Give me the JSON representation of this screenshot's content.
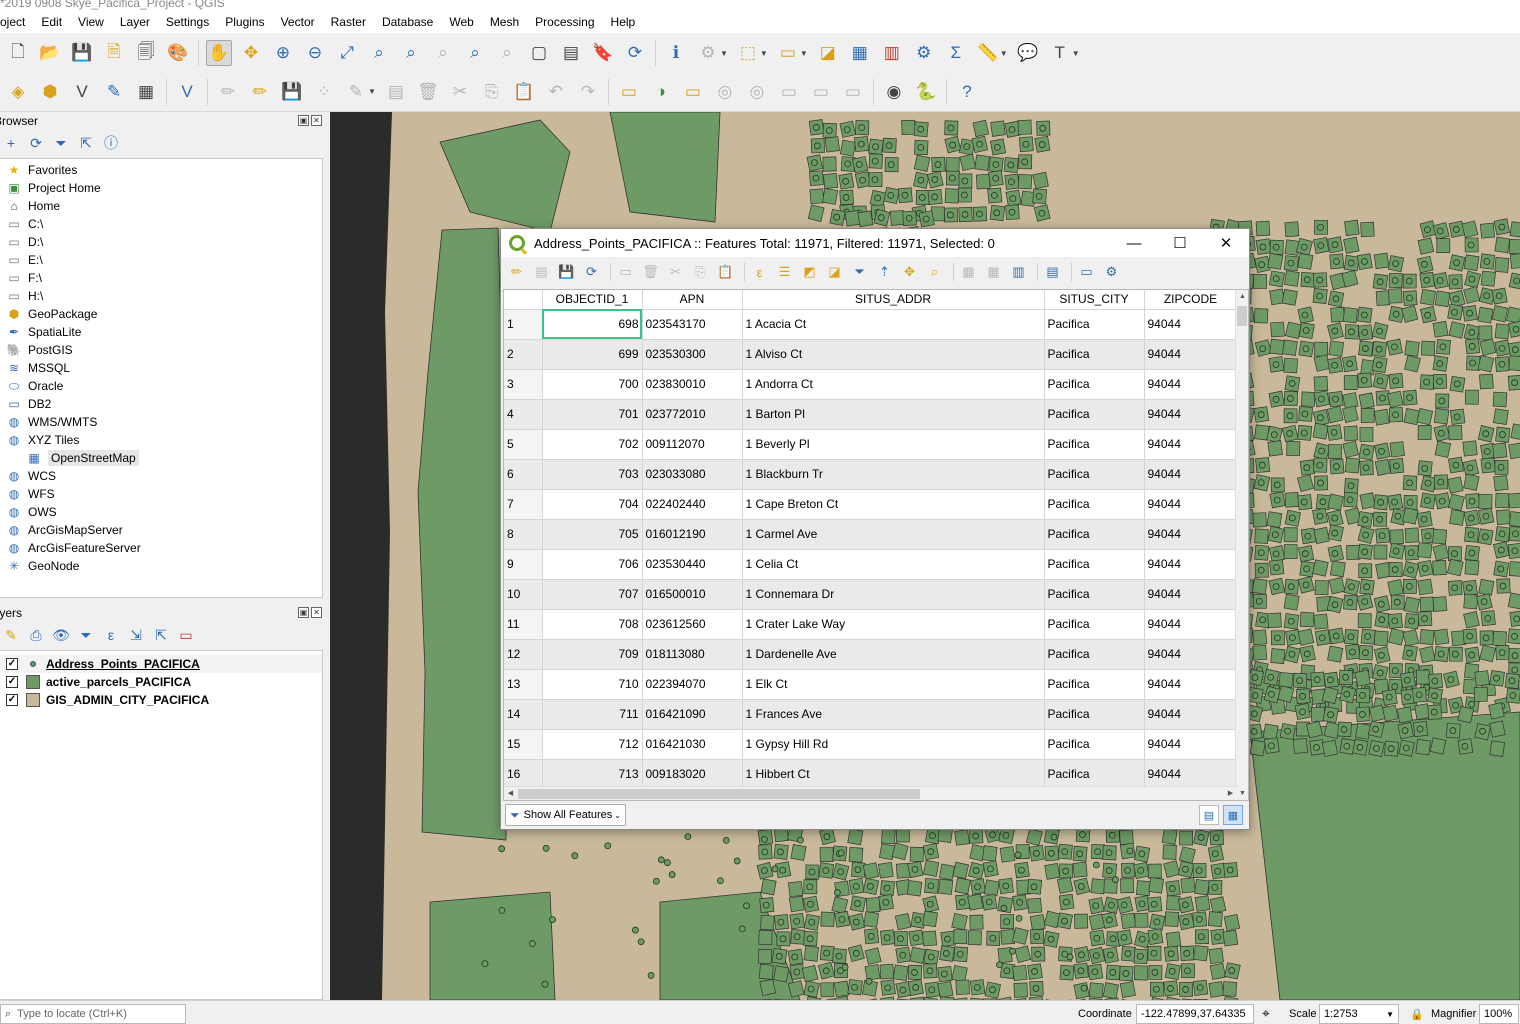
{
  "window": {
    "title": "*2019 0908 Skye_Pacifica_Project - QGIS"
  },
  "menu": [
    "Project",
    "Edit",
    "View",
    "Layer",
    "Settings",
    "Plugins",
    "Vector",
    "Raster",
    "Database",
    "Web",
    "Mesh",
    "Processing",
    "Help"
  ],
  "browser": {
    "title": "Browser",
    "items": [
      {
        "label": "Favorites",
        "icon": "star-icon"
      },
      {
        "label": "Project Home",
        "icon": "project-home-icon"
      },
      {
        "label": "Home",
        "icon": "home-folder-icon"
      },
      {
        "label": "C:\\",
        "icon": "drive-icon"
      },
      {
        "label": "D:\\",
        "icon": "drive-icon"
      },
      {
        "label": "E:\\",
        "icon": "drive-icon"
      },
      {
        "label": "F:\\",
        "icon": "drive-icon"
      },
      {
        "label": "H:\\",
        "icon": "drive-icon"
      },
      {
        "label": "GeoPackage",
        "icon": "geopackage-icon"
      },
      {
        "label": "SpatiaLite",
        "icon": "spatialite-icon"
      },
      {
        "label": "PostGIS",
        "icon": "postgis-icon"
      },
      {
        "label": "MSSQL",
        "icon": "mssql-icon"
      },
      {
        "label": "Oracle",
        "icon": "oracle-icon"
      },
      {
        "label": "DB2",
        "icon": "db2-icon"
      },
      {
        "label": "WMS/WMTS",
        "icon": "globe-icon"
      },
      {
        "label": "XYZ Tiles",
        "icon": "globe-icon"
      },
      {
        "label": "OpenStreetMap",
        "icon": "tiles-icon"
      },
      {
        "label": "WCS",
        "icon": "globe-icon"
      },
      {
        "label": "WFS",
        "icon": "globe-icon"
      },
      {
        "label": "OWS",
        "icon": "globe-icon"
      },
      {
        "label": "ArcGisMapServer",
        "icon": "globe-icon"
      },
      {
        "label": "ArcGisFeatureServer",
        "icon": "globe-icon"
      },
      {
        "label": "GeoNode",
        "icon": "geonode-icon"
      }
    ]
  },
  "layers_panel": {
    "title": "Layers",
    "layers": [
      {
        "name": "Address_Points_PACIFICA",
        "checked": true,
        "active": true,
        "color": "#5a9a8a"
      },
      {
        "name": "active_parcels_PACIFICA",
        "checked": true,
        "active": false,
        "color": "#6e9a66"
      },
      {
        "name": "GIS_ADMIN_CITY_PACIFICA",
        "checked": true,
        "active": false,
        "color": "#c9b99a"
      }
    ]
  },
  "attribute_table": {
    "title": "Address_Points_PACIFICA :: Features Total: 11971, Filtered: 11971, Selected: 0",
    "columns": [
      "OBJECTID_1",
      "APN",
      "SITUS_ADDR",
      "SITUS_CITY",
      "ZIPCODE"
    ],
    "rows": [
      {
        "n": "1",
        "oid": "698",
        "apn": "023543170",
        "addr": "1 Acacia Ct",
        "city": "Pacifica",
        "zip": "94044"
      },
      {
        "n": "2",
        "oid": "699",
        "apn": "023530300",
        "addr": "1 Alviso Ct",
        "city": "Pacifica",
        "zip": "94044"
      },
      {
        "n": "3",
        "oid": "700",
        "apn": "023830010",
        "addr": "1 Andorra Ct",
        "city": "Pacifica",
        "zip": "94044"
      },
      {
        "n": "4",
        "oid": "701",
        "apn": "023772010",
        "addr": "1 Barton Pl",
        "city": "Pacifica",
        "zip": "94044"
      },
      {
        "n": "5",
        "oid": "702",
        "apn": "009112070",
        "addr": "1 Beverly Pl",
        "city": "Pacifica",
        "zip": "94044"
      },
      {
        "n": "6",
        "oid": "703",
        "apn": "023033080",
        "addr": "1 Blackburn Tr",
        "city": "Pacifica",
        "zip": "94044"
      },
      {
        "n": "7",
        "oid": "704",
        "apn": "022402440",
        "addr": "1 Cape Breton Ct",
        "city": "Pacifica",
        "zip": "94044"
      },
      {
        "n": "8",
        "oid": "705",
        "apn": "016012190",
        "addr": "1 Carmel Ave",
        "city": "Pacifica",
        "zip": "94044"
      },
      {
        "n": "9",
        "oid": "706",
        "apn": "023530440",
        "addr": "1 Celia Ct",
        "city": "Pacifica",
        "zip": "94044"
      },
      {
        "n": "10",
        "oid": "707",
        "apn": "016500010",
        "addr": "1 Connemara Dr",
        "city": "Pacifica",
        "zip": "94044"
      },
      {
        "n": "11",
        "oid": "708",
        "apn": "023612560",
        "addr": "1 Crater Lake Way",
        "city": "Pacifica",
        "zip": "94044"
      },
      {
        "n": "12",
        "oid": "709",
        "apn": "018113080",
        "addr": "1 Dardenelle Ave",
        "city": "Pacifica",
        "zip": "94044"
      },
      {
        "n": "13",
        "oid": "710",
        "apn": "022394070",
        "addr": "1 Elk Ct",
        "city": "Pacifica",
        "zip": "94044"
      },
      {
        "n": "14",
        "oid": "711",
        "apn": "016421090",
        "addr": "1 Frances Ave",
        "city": "Pacifica",
        "zip": "94044"
      },
      {
        "n": "15",
        "oid": "712",
        "apn": "016421030",
        "addr": "1 Gypsy Hill Rd",
        "city": "Pacifica",
        "zip": "94044"
      },
      {
        "n": "16",
        "oid": "713",
        "apn": "009183020",
        "addr": "1 Hibbert Ct",
        "city": "Pacifica",
        "zip": "94044"
      }
    ],
    "filter_button": "Show All Features"
  },
  "status": {
    "locate_placeholder": "Type to locate (Ctrl+K)",
    "coordinate_label": "Coordinate",
    "coordinate_value": "-122.47899,37.64335",
    "scale_label": "Scale",
    "scale_value": "1:2753",
    "magnifier_label": "Magnifier",
    "magnifier_value": "100%"
  },
  "colors": {
    "parcel": "#6e9a66",
    "ground": "#c9b99a",
    "water": "#2b2b2b",
    "accent": "#3bc28a"
  }
}
